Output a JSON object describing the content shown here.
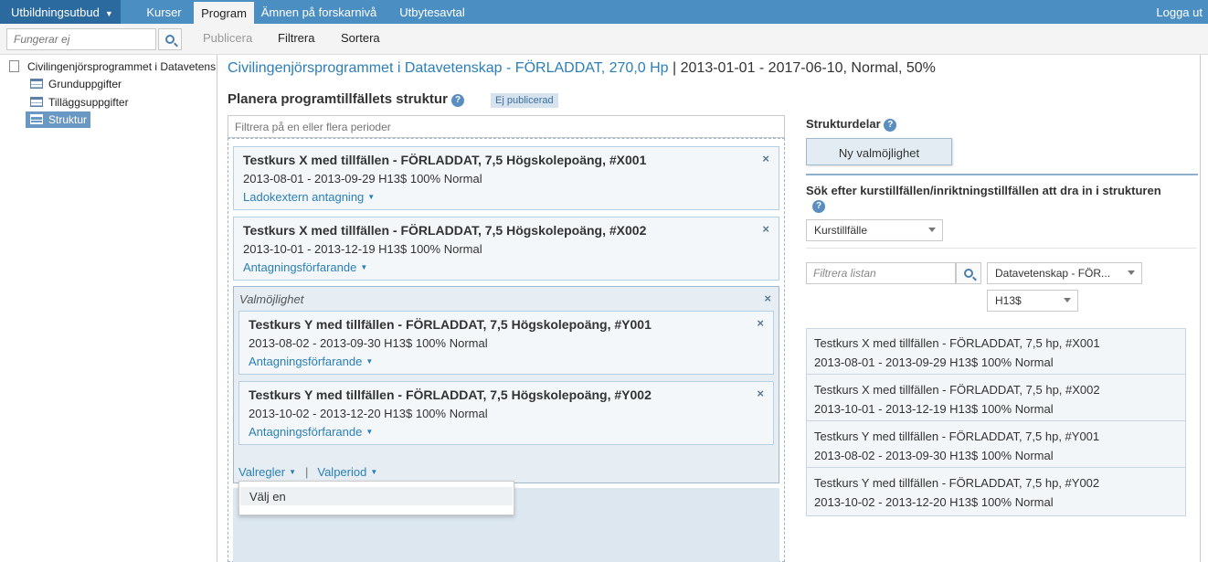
{
  "nav": {
    "menu_label": "Utbildningsutbud",
    "tabs": [
      {
        "label": "Kurser"
      },
      {
        "label": "Program"
      },
      {
        "label": "Ämnen på forskarnivå"
      },
      {
        "label": "Utbytesavtal"
      }
    ],
    "logout": "Logga ut"
  },
  "toolbar": {
    "search_placeholder": "Fungerar ej",
    "publish": "Publicera",
    "filter": "Filtrera",
    "sort": "Sortera"
  },
  "sidebar": {
    "root": "Civilingenjörsprogrammet i Datavetenskap",
    "items": [
      {
        "label": "Grunduppgifter"
      },
      {
        "label": "Tilläggsuppgifter"
      },
      {
        "label": "Struktur"
      }
    ]
  },
  "main": {
    "title_link": "Civilingenjörsprogrammet i Datavetenskap - FÖRLADDAT, 270,0 Hp",
    "title_rest": "| 2013-01-01 - 2017-06-10, Normal, 50%",
    "section_title": "Planera programtillfällets struktur",
    "status_badge": "Ej publicerad",
    "period_filter_placeholder": "Filtrera på en eller flera perioder",
    "courses": [
      {
        "title": "Testkurs X med tillfällen - FÖRLADDAT, 7,5 Högskolepoäng, #X001",
        "dates": "2013-08-01 - 2013-09-29 H13$ 100% Normal",
        "admission": "Ladokextern antagning"
      },
      {
        "title": "Testkurs X med tillfällen - FÖRLADDAT, 7,5 Högskolepoäng, #X002",
        "dates": "2013-10-01 - 2013-12-19 H13$ 100% Normal",
        "admission": "Antagningsförfarande"
      }
    ],
    "choice": {
      "label": "Valmöjlighet",
      "courses": [
        {
          "title": "Testkurs Y med tillfällen - FÖRLADDAT, 7,5 Högskolepoäng, #Y001",
          "dates": "2013-08-02 - 2013-09-30 H13$ 100% Normal",
          "admission": "Antagningsförfarande"
        },
        {
          "title": "Testkurs Y med tillfällen - FÖRLADDAT, 7,5 Högskolepoäng, #Y002",
          "dates": "2013-10-02 - 2013-12-20 H13$ 100% Normal",
          "admission": "Antagningsförfarande"
        }
      ],
      "rules": "Valregler",
      "period": "Valperiod",
      "dropdown_option": "Välj en"
    }
  },
  "right": {
    "parts_title": "Strukturdelar",
    "new_choice": "Ny valmöjlighet",
    "search_title": "Sök efter kurstillfällen/inriktningstillfällen att dra in i strukturen",
    "type_select": "Kurstillfälle",
    "list_filter_placeholder": "Filtrera listan",
    "dept_select": "Datavetenskap - FÖR...",
    "term_select": "H13$",
    "results": [
      {
        "title": "Testkurs X med tillfällen - FÖRLADDAT, 7,5 hp, #X001",
        "dates": "2013-08-01 - 2013-09-29 H13$ 100% Normal"
      },
      {
        "title": "Testkurs X med tillfällen - FÖRLADDAT, 7,5 hp, #X002",
        "dates": "2013-10-01 - 2013-12-19 H13$ 100% Normal"
      },
      {
        "title": "Testkurs Y med tillfällen - FÖRLADDAT, 7,5 hp, #Y001",
        "dates": "2013-08-02 - 2013-09-30 H13$ 100% Normal"
      },
      {
        "title": "Testkurs Y med tillfällen - FÖRLADDAT, 7,5 hp, #Y002",
        "dates": "2013-10-02 - 2013-12-20 H13$ 100% Normal"
      }
    ]
  },
  "colors": {
    "nav_bg": "#4a8ec2",
    "menu_bg": "#2b6a9e",
    "link": "#2a7fb8",
    "selected": "#6a98c4"
  }
}
